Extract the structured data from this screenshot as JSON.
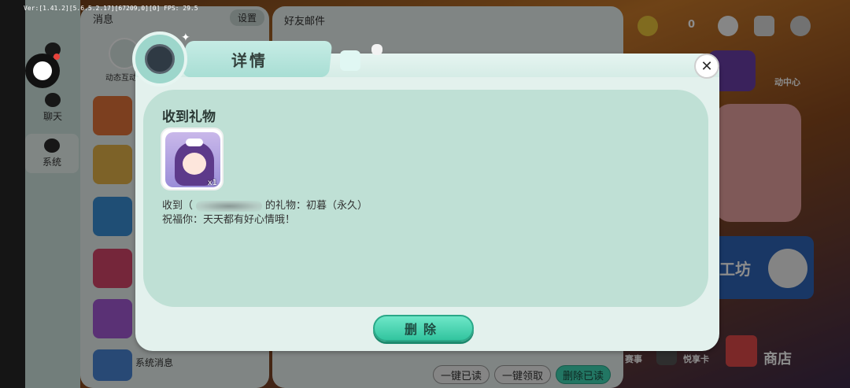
{
  "debug": {
    "version_text": "Ver:[1.41.2][5.6.5.2.17][67209,0][0] FPS: 29.5"
  },
  "side_nav": {
    "items": [
      {
        "label": ""
      },
      {
        "label": "聊天"
      },
      {
        "label": "系统"
      }
    ]
  },
  "messages_panel": {
    "title": "消息",
    "settings_label": "设置",
    "dynamic_label": "动态互动",
    "system_message_label": "系统消息"
  },
  "mail_panel": {
    "title": "好友邮件",
    "buttons": {
      "read_all": "一键已读",
      "claim_all": "一键领取",
      "delete_read": "删除已读"
    }
  },
  "background": {
    "coin_count": "0",
    "activity_label": "动中心",
    "workshop_label": "工坊",
    "shop_label": "商店",
    "event_label": "赛事",
    "card_label": "悦享卡"
  },
  "modal": {
    "title": "详情",
    "content_title": "收到礼物",
    "gift_qty": "x1",
    "line1_prefix": "收到（",
    "line1_suffix": "的礼物：初暮（永久）",
    "line2": "祝福你：天天都有好心情哦！",
    "delete_label": "删除",
    "close_glyph": "✕"
  },
  "colors": {
    "accent": "#3fd8b4",
    "panel": "#bfe0d5"
  }
}
